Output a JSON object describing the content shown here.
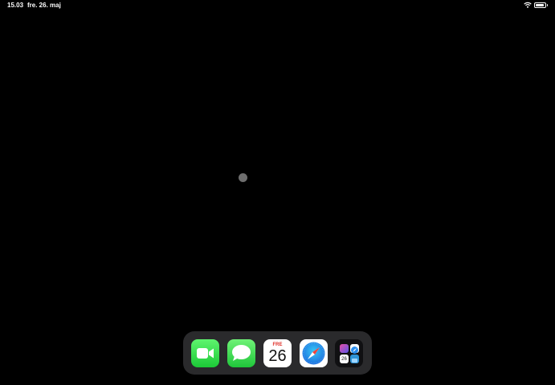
{
  "status_bar": {
    "time": "15.03",
    "date": "fre. 26. maj",
    "battery_level": 0.9
  },
  "dock": {
    "apps": [
      {
        "name": "FaceTime",
        "icon": "facetime-icon"
      },
      {
        "name": "Messages",
        "icon": "messages-icon"
      },
      {
        "name": "Calendar",
        "icon": "calendar-icon",
        "weekday": "FRE",
        "date": "26"
      },
      {
        "name": "Safari",
        "icon": "safari-icon"
      },
      {
        "name": "Folder",
        "icon": "app-folder-icon",
        "mini_calendar_date": "26"
      }
    ]
  },
  "colors": {
    "background": "#000000",
    "dock": "#2a2a2c",
    "assistive_touch": "#6e6e6e"
  }
}
